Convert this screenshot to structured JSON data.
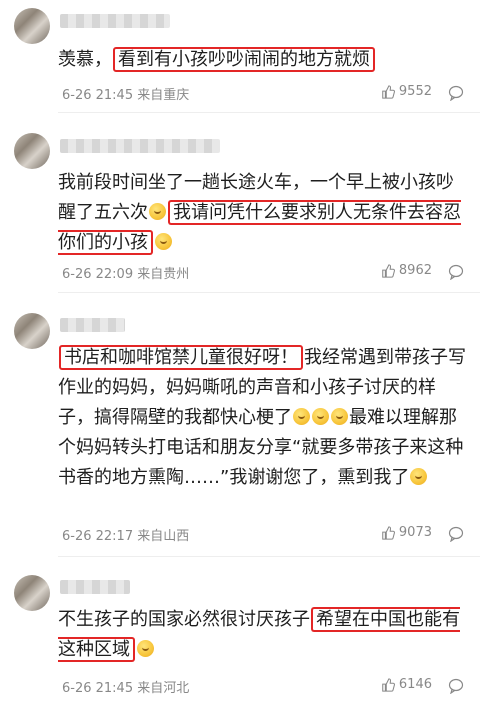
{
  "comments": [
    {
      "segments": [
        {
          "text": "羡慕，",
          "hl": false
        },
        {
          "text": "看到有小孩吵吵闹闹的地方就烦",
          "hl": true
        }
      ],
      "time": "6-26 21:45",
      "location": "来自重庆",
      "likes": "9552"
    },
    {
      "segments": [
        {
          "text": "我前段时间坐了一趟长途火车，",
          "hl": false
        },
        {
          "text": "一个早上被小孩吵醒了五六次",
          "hl": true
        },
        {
          "emoji": "crying-laugh-emoji"
        },
        {
          "text": "我请问凭什么要求别人无条件去容忍你们的小孩",
          "hl": true
        },
        {
          "emoji": "crying-laugh-emoji"
        }
      ],
      "time": "6-26 22:09",
      "location": "来自贵州",
      "likes": "8962"
    },
    {
      "segments": [
        {
          "text": "书店和咖啡馆禁儿童很好呀！",
          "hl": true
        },
        {
          "text": "我经常遇到带孩子写作业的妈妈，妈妈嘶吼的声音和小孩子讨厌的样子，搞得隔壁的我都快心梗了",
          "hl": false
        },
        {
          "emoji": "crying-emoji"
        },
        {
          "emoji": "crying-emoji"
        },
        {
          "emoji": "crying-emoji"
        },
        {
          "text": "最难以理解那个妈妈转头打电话和朋友分享“就要多带孩子来这种书香的地方熏陶……”我谢谢您了，熏到我了",
          "hl": false
        },
        {
          "emoji": "crying-emoji"
        }
      ],
      "time": "6-26 22:17",
      "location": "来自山西",
      "likes": "9073"
    },
    {
      "segments": [
        {
          "text": "不生孩子的国家必然很讨厌孩子",
          "hl": false
        },
        {
          "text": "希望在中国也能有这种区域",
          "hl": true
        },
        {
          "emoji": "smile-emoji"
        }
      ],
      "time": "6-26 21:45",
      "location": "来自河北",
      "likes": "6146"
    }
  ]
}
